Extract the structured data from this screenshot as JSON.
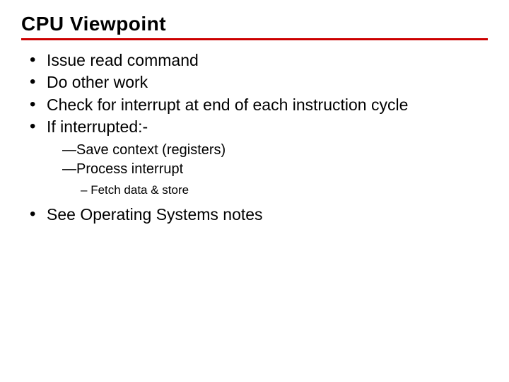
{
  "title": "CPU Viewpoint",
  "bullets": {
    "b1": "Issue read command",
    "b2": "Do other work",
    "b3": "Check for interrupt at end of each instruction cycle",
    "b4": "If interrupted:-",
    "b4_sub1_prefix": "—",
    "b4_sub1": "Save context (registers)",
    "b4_sub2_prefix": "—",
    "b4_sub2": "Process interrupt",
    "b4_sub2_sub1_prefix": "– ",
    "b4_sub2_sub1": "Fetch data & store",
    "b5": "See Operating Systems notes"
  }
}
